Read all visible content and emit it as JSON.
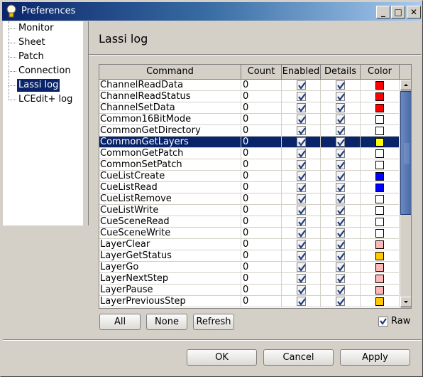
{
  "window": {
    "title": "Preferences",
    "minimize": "_",
    "maximize": "□",
    "close": "✕",
    "icon": "lightbulb-icon"
  },
  "tree": {
    "items": [
      {
        "label": "Monitor",
        "selected": false
      },
      {
        "label": "Sheet",
        "selected": false
      },
      {
        "label": "Patch",
        "selected": false
      },
      {
        "label": "Connection",
        "selected": false
      },
      {
        "label": "Lassi log",
        "selected": true
      },
      {
        "label": "LCEdit+ log",
        "selected": false
      }
    ]
  },
  "panel": {
    "heading": "Lassi log"
  },
  "table": {
    "columns": [
      "Command",
      "Count",
      "Enabled",
      "Details",
      "Color"
    ],
    "rows": [
      {
        "command": "ChannelReadData",
        "count": "0",
        "enabled": true,
        "details": true,
        "color": "#ff0000"
      },
      {
        "command": "ChannelReadStatus",
        "count": "0",
        "enabled": true,
        "details": true,
        "color": "#ff0000"
      },
      {
        "command": "ChannelSetData",
        "count": "0",
        "enabled": true,
        "details": true,
        "color": "#ff0000"
      },
      {
        "command": "Common16BitMode",
        "count": "0",
        "enabled": true,
        "details": true,
        "color": "#ffffff"
      },
      {
        "command": "CommonGetDirectory",
        "count": "0",
        "enabled": true,
        "details": true,
        "color": "#ffffff"
      },
      {
        "command": "CommonGetLayers",
        "count": "0",
        "enabled": true,
        "details": true,
        "color": "#ffff00",
        "selected": true
      },
      {
        "command": "CommonGetPatch",
        "count": "0",
        "enabled": true,
        "details": true,
        "color": "#ffffff"
      },
      {
        "command": "CommonSetPatch",
        "count": "0",
        "enabled": true,
        "details": true,
        "color": "#ffffff"
      },
      {
        "command": "CueListCreate",
        "count": "0",
        "enabled": true,
        "details": true,
        "color": "#0000ff"
      },
      {
        "command": "CueListRead",
        "count": "0",
        "enabled": true,
        "details": true,
        "color": "#0000ff"
      },
      {
        "command": "CueListRemove",
        "count": "0",
        "enabled": true,
        "details": true,
        "color": "#ffffff"
      },
      {
        "command": "CueListWrite",
        "count": "0",
        "enabled": true,
        "details": true,
        "color": "#ffffff"
      },
      {
        "command": "CueSceneRead",
        "count": "0",
        "enabled": true,
        "details": true,
        "color": "#ffffff"
      },
      {
        "command": "CueSceneWrite",
        "count": "0",
        "enabled": true,
        "details": true,
        "color": "#ffffff"
      },
      {
        "command": "LayerClear",
        "count": "0",
        "enabled": true,
        "details": true,
        "color": "#ffb6b6"
      },
      {
        "command": "LayerGetStatus",
        "count": "0",
        "enabled": true,
        "details": true,
        "color": "#ffc800"
      },
      {
        "command": "LayerGo",
        "count": "0",
        "enabled": true,
        "details": true,
        "color": "#ffb6b6"
      },
      {
        "command": "LayerNextStep",
        "count": "0",
        "enabled": true,
        "details": true,
        "color": "#ffb6b6"
      },
      {
        "command": "LayerPause",
        "count": "0",
        "enabled": true,
        "details": true,
        "color": "#ffb6b6"
      },
      {
        "command": "LayerPreviousStep",
        "count": "0",
        "enabled": true,
        "details": true,
        "color": "#ffc800"
      }
    ]
  },
  "actions": {
    "all": "All",
    "none": "None",
    "refresh": "Refresh",
    "raw_label": "Raw",
    "raw_checked": true
  },
  "footer": {
    "ok": "OK",
    "cancel": "Cancel",
    "apply": "Apply"
  },
  "colors": {
    "selection": "#0a246a",
    "check": "#1f3a7a"
  }
}
